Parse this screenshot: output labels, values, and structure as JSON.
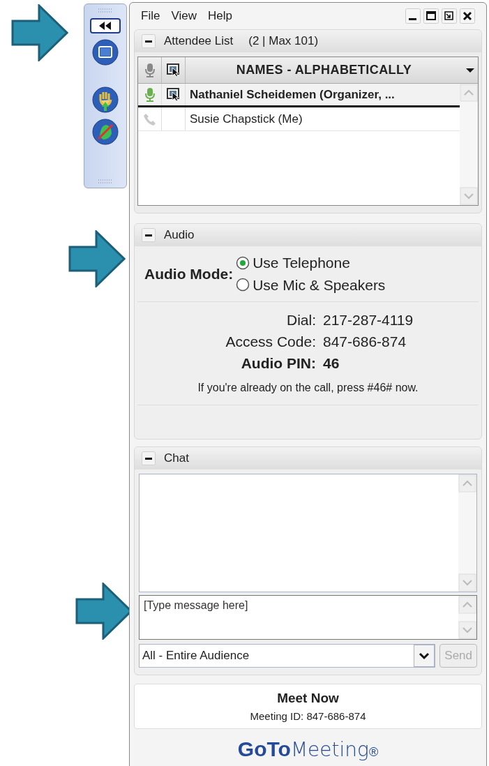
{
  "menu": [
    "File",
    "View",
    "Help"
  ],
  "attendees": {
    "title": "Attendee List",
    "count": "(2 | Max 101)",
    "column": "NAMES - ALPHABETICALLY",
    "rows": [
      {
        "name": "Nathaniel Scheidemen (Organizer, ...",
        "kind": "mic",
        "presenter": true,
        "highlighted": true
      },
      {
        "name": "Susie Chapstick (Me)",
        "kind": "phone",
        "presenter": false,
        "highlighted": false
      }
    ]
  },
  "audio": {
    "title": "Audio",
    "mode_label": "Audio Mode:",
    "options": [
      {
        "label": "Use Telephone",
        "selected": true
      },
      {
        "label": "Use Mic & Speakers",
        "selected": false
      }
    ],
    "details": [
      {
        "label": "Dial:",
        "value": "217-287-4119",
        "bold": false
      },
      {
        "label": "Access Code:",
        "value": "847-686-874",
        "bold": false
      },
      {
        "label": "Audio PIN:",
        "value": "46",
        "bold": true
      }
    ],
    "note": "If you're already on the call, press #46# now."
  },
  "chat": {
    "title": "Chat",
    "placeholder": "[Type message here]",
    "recipient": "All - Entire Audience",
    "send": "Send",
    "send_disabled": true
  },
  "footer": {
    "title": "Meet Now",
    "meeting_id": "Meeting ID: 847-686-874",
    "logo_bold": "GoTo",
    "logo_light": "Meeting",
    "logo_mark": "®"
  }
}
